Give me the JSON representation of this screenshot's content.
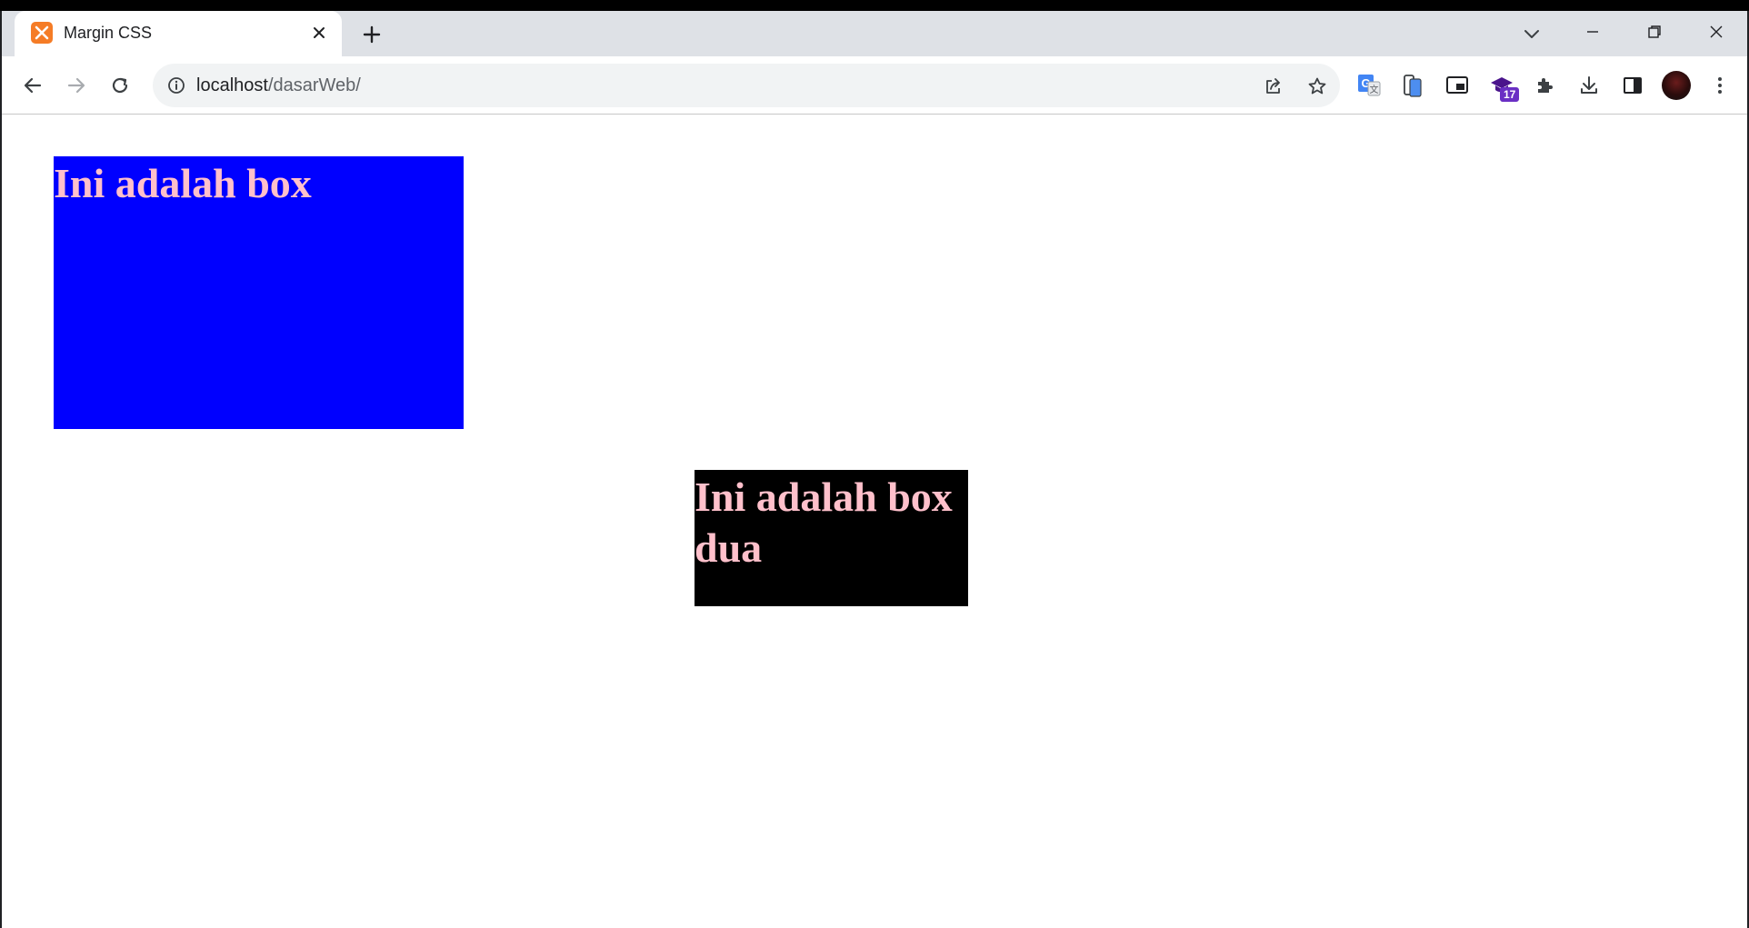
{
  "browser": {
    "tab": {
      "title": "Margin CSS",
      "favicon": "xampp-icon"
    },
    "new_tab_icon": "plus-icon",
    "address_bar": {
      "host": "localhost",
      "path": "/dasarWeb/"
    },
    "extension_badge": "17"
  },
  "page": {
    "box1": {
      "text": "Ini adalah box",
      "background": "#0000ff",
      "text_color": "#ffc0cb"
    },
    "box2": {
      "text": "Ini adalah box dua",
      "background": "#000000",
      "text_color": "#ffc0cb"
    }
  }
}
